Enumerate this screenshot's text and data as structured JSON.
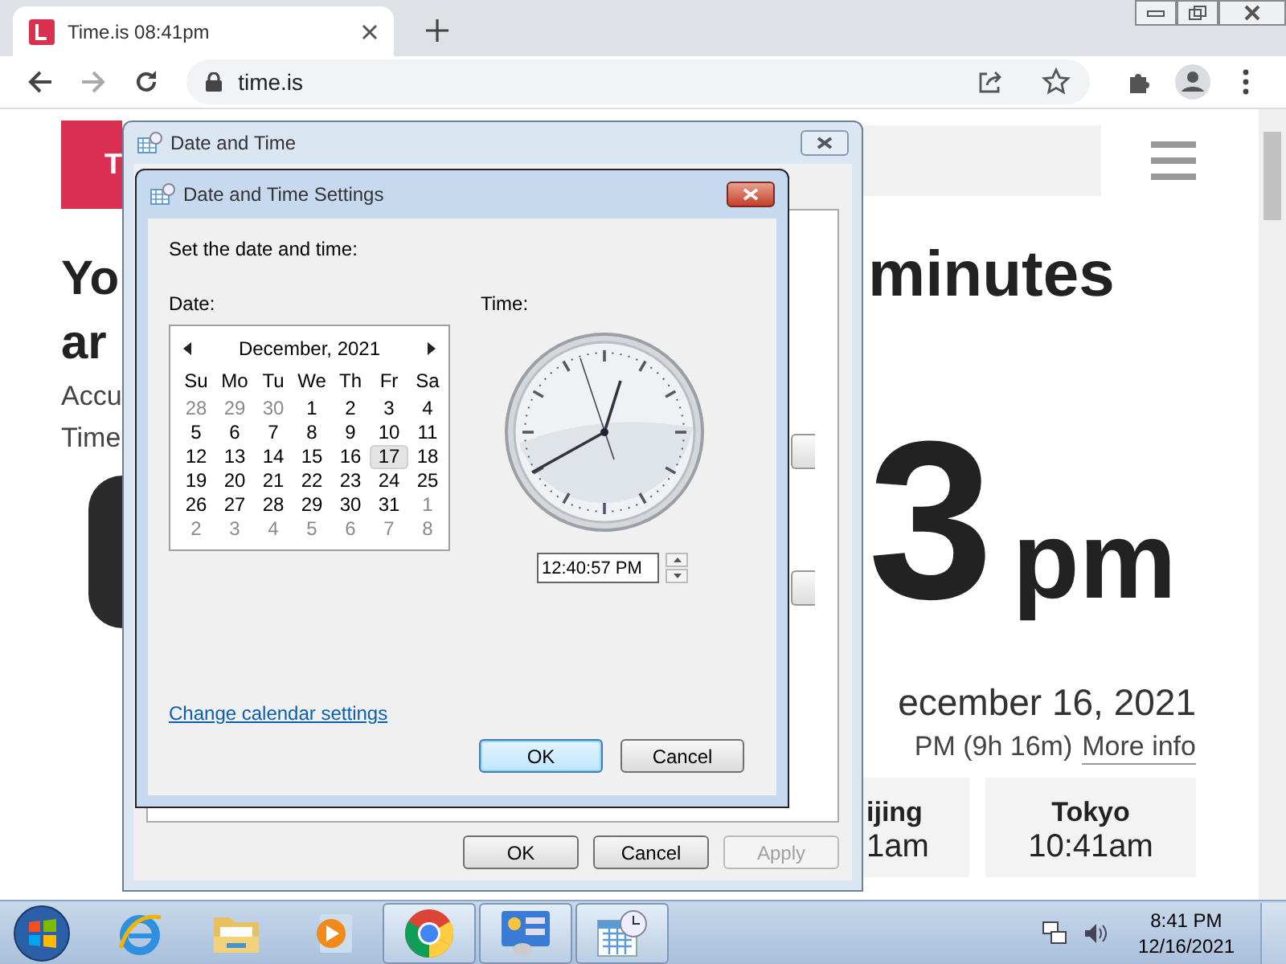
{
  "browser": {
    "tab_title": "Time.is 08:41pm",
    "address": "time.is"
  },
  "page": {
    "header_letter": "T",
    "headline_left": [
      "Yo",
      "ar"
    ],
    "subtitle_left": [
      "Accu",
      "Time"
    ],
    "headline_right": "minutes",
    "big_time": "3",
    "big_suffix": "pm",
    "date": "ecember 16, 2021",
    "sun_info": "PM (9h 16m)",
    "more_info": "More info",
    "cities": [
      {
        "name": "ijing",
        "time": "1am"
      },
      {
        "name": "Tokyo",
        "time": "10:41am"
      }
    ]
  },
  "date_time_window": {
    "title": "Date and Time",
    "buttons": [
      {
        "label": "OK",
        "disabled": false
      },
      {
        "label": "Cancel",
        "disabled": false
      },
      {
        "label": "Apply",
        "disabled": true
      }
    ]
  },
  "settings_dialog": {
    "title": "Date and Time Settings",
    "instruction": "Set the date and time:",
    "date_label": "Date:",
    "time_label": "Time:",
    "calendar": {
      "month": "December, 2021",
      "weekdays": [
        "Su",
        "Mo",
        "Tu",
        "We",
        "Th",
        "Fr",
        "Sa"
      ],
      "weeks": [
        [
          {
            "day": "28",
            "muted": true,
            "selected": false
          },
          {
            "day": "29",
            "muted": true,
            "selected": false
          },
          {
            "day": "30",
            "muted": true,
            "selected": false
          },
          {
            "day": "1",
            "muted": false,
            "selected": false
          },
          {
            "day": "2",
            "muted": false,
            "selected": false
          },
          {
            "day": "3",
            "muted": false,
            "selected": false
          },
          {
            "day": "4",
            "muted": false,
            "selected": false
          }
        ],
        [
          {
            "day": "5",
            "muted": false,
            "selected": false
          },
          {
            "day": "6",
            "muted": false,
            "selected": false
          },
          {
            "day": "7",
            "muted": false,
            "selected": false
          },
          {
            "day": "8",
            "muted": false,
            "selected": false
          },
          {
            "day": "9",
            "muted": false,
            "selected": false
          },
          {
            "day": "10",
            "muted": false,
            "selected": false
          },
          {
            "day": "11",
            "muted": false,
            "selected": false
          }
        ],
        [
          {
            "day": "12",
            "muted": false,
            "selected": false
          },
          {
            "day": "13",
            "muted": false,
            "selected": false
          },
          {
            "day": "14",
            "muted": false,
            "selected": false
          },
          {
            "day": "15",
            "muted": false,
            "selected": false
          },
          {
            "day": "16",
            "muted": false,
            "selected": false
          },
          {
            "day": "17",
            "muted": false,
            "selected": true
          },
          {
            "day": "18",
            "muted": false,
            "selected": false
          }
        ],
        [
          {
            "day": "19",
            "muted": false,
            "selected": false
          },
          {
            "day": "20",
            "muted": false,
            "selected": false
          },
          {
            "day": "21",
            "muted": false,
            "selected": false
          },
          {
            "day": "22",
            "muted": false,
            "selected": false
          },
          {
            "day": "23",
            "muted": false,
            "selected": false
          },
          {
            "day": "24",
            "muted": false,
            "selected": false
          },
          {
            "day": "25",
            "muted": false,
            "selected": false
          }
        ],
        [
          {
            "day": "26",
            "muted": false,
            "selected": false
          },
          {
            "day": "27",
            "muted": false,
            "selected": false
          },
          {
            "day": "28",
            "muted": false,
            "selected": false
          },
          {
            "day": "29",
            "muted": false,
            "selected": false
          },
          {
            "day": "30",
            "muted": false,
            "selected": false
          },
          {
            "day": "31",
            "muted": false,
            "selected": false
          },
          {
            "day": "1",
            "muted": true,
            "selected": false
          }
        ],
        [
          {
            "day": "2",
            "muted": true,
            "selected": false
          },
          {
            "day": "3",
            "muted": true,
            "selected": false
          },
          {
            "day": "4",
            "muted": true,
            "selected": false
          },
          {
            "day": "5",
            "muted": true,
            "selected": false
          },
          {
            "day": "6",
            "muted": true,
            "selected": false
          },
          {
            "day": "7",
            "muted": true,
            "selected": false
          },
          {
            "day": "8",
            "muted": true,
            "selected": false
          }
        ]
      ]
    },
    "time_value": "12:40:57 PM",
    "link": "Change calendar settings",
    "buttons": [
      {
        "label": "OK",
        "default": true
      },
      {
        "label": "Cancel",
        "default": false
      }
    ]
  },
  "taskbar": {
    "apps": [
      {
        "kind": "ie",
        "active": false
      },
      {
        "kind": "explorer",
        "active": false
      },
      {
        "kind": "media",
        "active": false
      },
      {
        "kind": "chrome",
        "active": true
      },
      {
        "kind": "control-panel",
        "active": true
      },
      {
        "kind": "calendar",
        "active": true
      }
    ],
    "clock_time": "8:41 PM",
    "clock_date": "12/16/2021"
  }
}
